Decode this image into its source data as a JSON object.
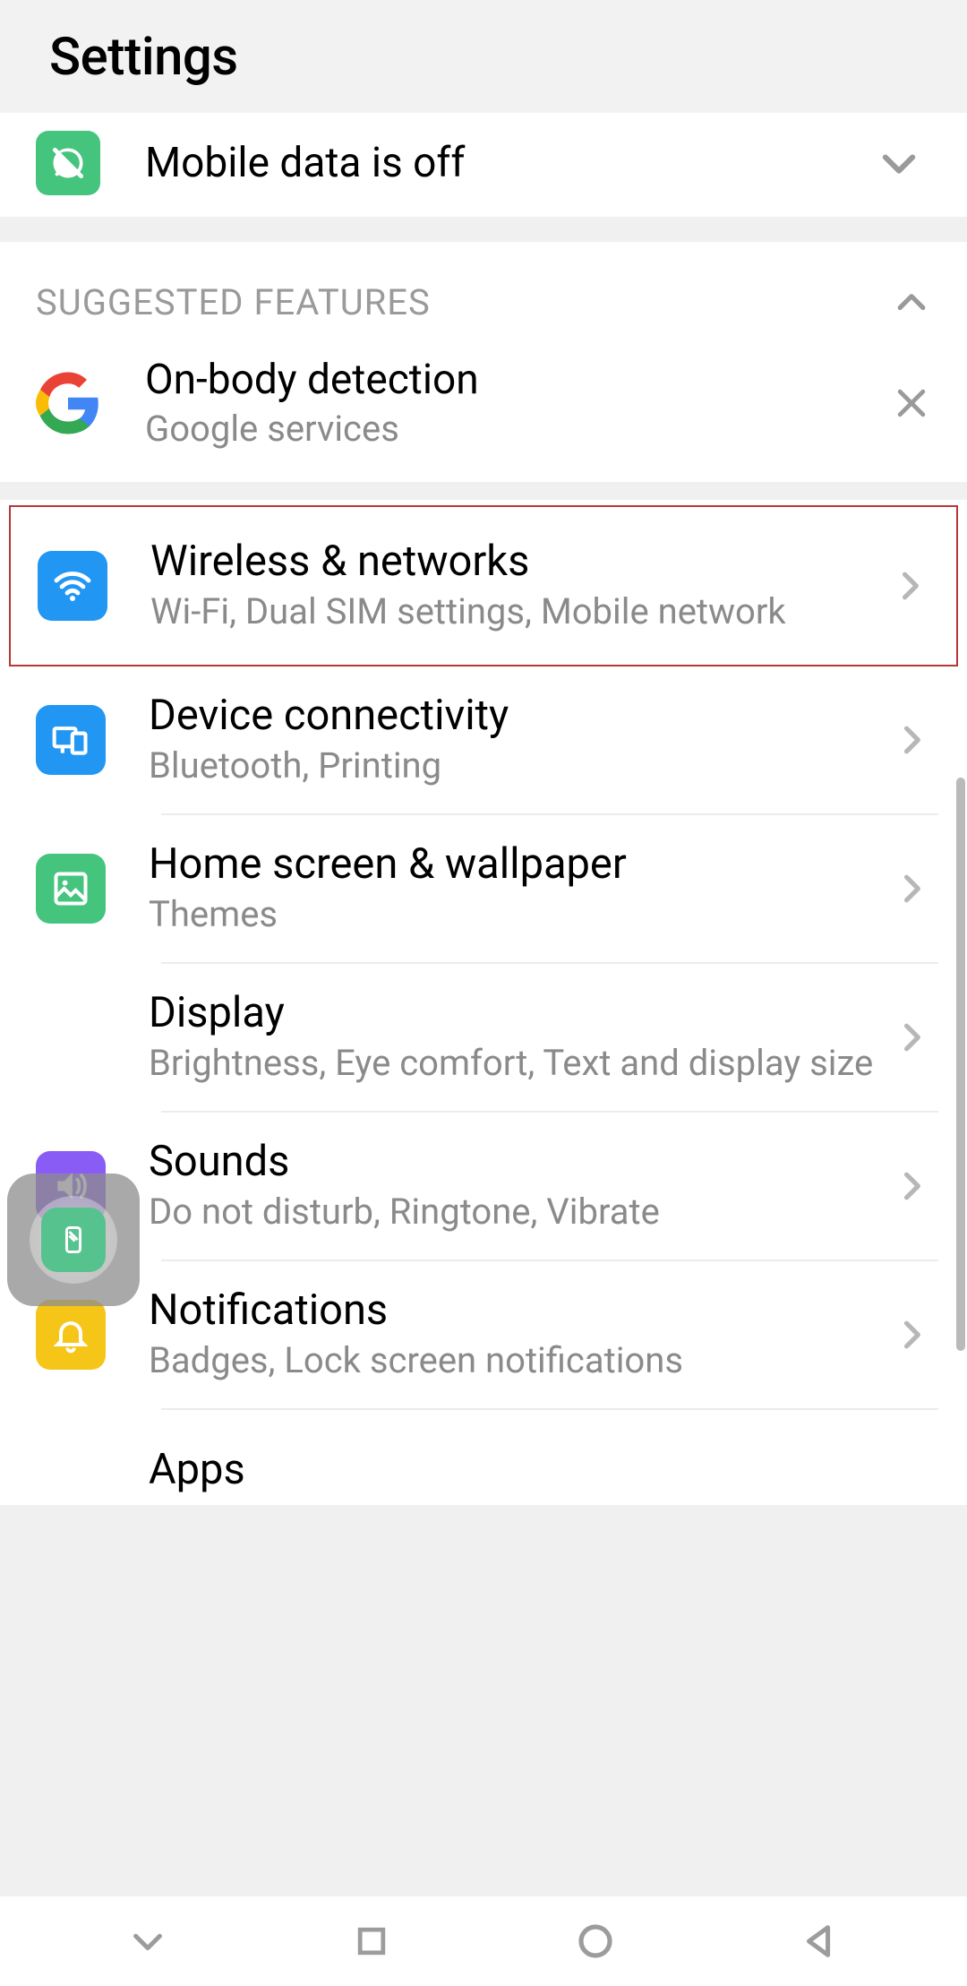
{
  "header": {
    "title": "Settings"
  },
  "banner": {
    "text": "Mobile data is off"
  },
  "suggested": {
    "heading": "SUGGESTED FEATURES",
    "item": {
      "title": "On-body detection",
      "subtitle": "Google services"
    }
  },
  "rows": {
    "wireless": {
      "title": "Wireless & networks",
      "subtitle": "Wi-Fi, Dual SIM settings, Mobile network"
    },
    "device": {
      "title": "Device connectivity",
      "subtitle": "Bluetooth, Printing"
    },
    "home": {
      "title": "Home screen & wallpaper",
      "subtitle": "Themes"
    },
    "display": {
      "title": "Display",
      "subtitle": "Brightness, Eye comfort, Text and display size"
    },
    "sounds": {
      "title": "Sounds",
      "subtitle": "Do not disturb, Ringtone, Vibrate"
    },
    "notifications": {
      "title": "Notifications",
      "subtitle": "Badges, Lock screen notifications"
    },
    "apps": {
      "title": "Apps"
    }
  },
  "colors": {
    "green": "#45c47e",
    "blue": "#2196f3",
    "purple": "#8a5cf6",
    "yellow": "#f5c518",
    "highlight_border": "#b33939"
  }
}
